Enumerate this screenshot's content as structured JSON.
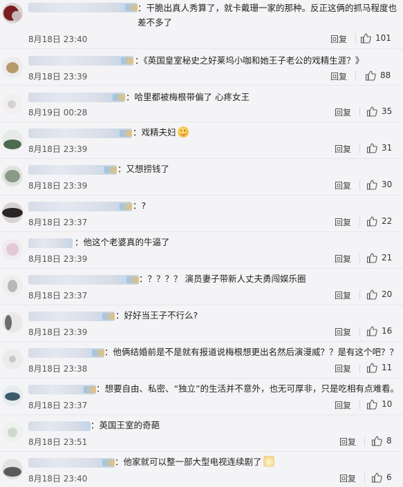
{
  "ui": {
    "reply_label": "回复",
    "like_icon": "thumbs-up-icon"
  },
  "comments": [
    {
      "text": "：干脆出真人秀算了，就卡戴珊一家的那种。反正这俩的抓马程度也差不多了",
      "time": "8月18日 23:40",
      "likes": "101"
    },
    {
      "text": "：《英国皇室秘史之好莱坞小咖和她王子老公的戏精生涯？》",
      "time": "8月18日 23:39",
      "likes": "88"
    },
    {
      "text": "：哈里都被梅根带偏了 心疼女王",
      "time": "8月19日 00:28",
      "likes": "35"
    },
    {
      "text": "：戏精夫妇",
      "time": "8月18日 23:39",
      "likes": "31"
    },
    {
      "text": "：又想捞钱了",
      "time": "8月18日 23:39",
      "likes": "30"
    },
    {
      "text": "：?",
      "time": "8月18日 23:37",
      "likes": "22"
    },
    {
      "text": "：他这个老婆真的牛逼了",
      "time": "8月18日 23:39",
      "likes": "21"
    },
    {
      "text": "：？？？？ 演员妻子带新人丈夫勇闯娱乐圈",
      "time": "8月18日 23:37",
      "likes": "20"
    },
    {
      "text": "：好好当王子不行么?",
      "time": "8月18日 23:39",
      "likes": "16"
    },
    {
      "text": "：他俩结婚前是不是就有报道说梅根想更出名然后演漫威？？是有这个吧？？",
      "time": "8月18日 23:38",
      "likes": "11"
    },
    {
      "text": "：想要自由、私密、“独立”的生活并不意外，也无可厚非，只是吃相有点难看。",
      "time": "8月18日 23:37",
      "likes": "10"
    },
    {
      "text": "：英国王室的奇葩",
      "time": "8月18日 23:51",
      "likes": "8"
    },
    {
      "text": "：他家就可以整一部大型电视连续剧了",
      "time": "8月18日 23:40",
      "likes": "6"
    }
  ]
}
